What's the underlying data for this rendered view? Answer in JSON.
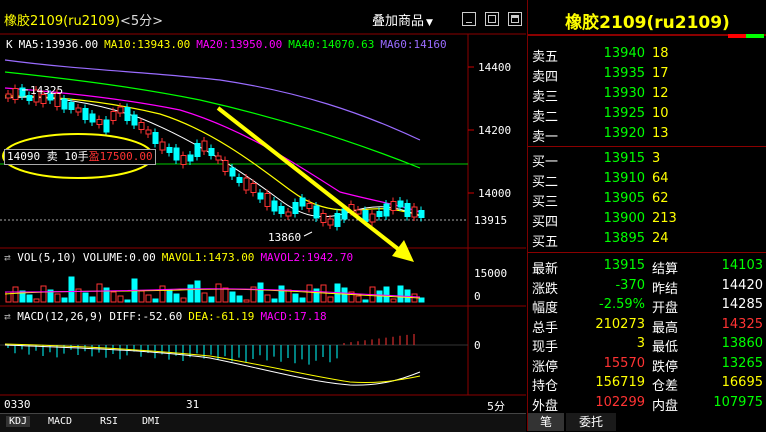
{
  "header": {
    "title": "橡胶2109(ru2109)",
    "period": "<5分>",
    "overlay_button": "叠加商品",
    "overlay_arrow": "▼"
  },
  "main": {
    "ma_legend": [
      {
        "label": "K",
        "color": "#ffffff"
      },
      {
        "label": "MA5:13936.00",
        "color": "#ffffff"
      },
      {
        "label": "MA10:13943.00",
        "color": "#ffff00"
      },
      {
        "label": "MA20:13950.00",
        "color": "#ff00ff"
      },
      {
        "label": "MA40:14070.63",
        "color": "#00ff00"
      },
      {
        "label": "MA60:14160",
        "color": "#9a6cff"
      }
    ],
    "price_ticks": [
      "14400",
      "14200",
      "14000"
    ],
    "current_price_tag": "13915",
    "high_label": "14325",
    "low_label": "13860",
    "order_tag": {
      "price": "14090",
      "side": "卖",
      "qty": "10手",
      "profit": "盈17500.00"
    }
  },
  "volume": {
    "legend": [
      {
        "label": "VOL(5,10)",
        "color": "#ffffff"
      },
      {
        "label": "VOLUME:0.00",
        "color": "#ffffff"
      },
      {
        "label": "MAVOL1:1473.00",
        "color": "#ffff00"
      },
      {
        "label": "MAVOL2:1942.70",
        "color": "#ff00ff"
      }
    ],
    "ticks": [
      "15000",
      "0"
    ]
  },
  "macd": {
    "legend": [
      {
        "label": "MACD(12,26,9)",
        "color": "#ffffff"
      },
      {
        "label": "DIFF:-52.60",
        "color": "#ffffff"
      },
      {
        "label": "DEA:-61.19",
        "color": "#ffff00"
      },
      {
        "label": "MACD:17.18",
        "color": "#ff00ff"
      }
    ],
    "ticks": [
      "0"
    ]
  },
  "time_axis": {
    "left": "0330",
    "mid": "31",
    "right": "5分"
  },
  "indicator_tabs": [
    "KDJ",
    "MACD",
    "RSI",
    "DMI"
  ],
  "quote": {
    "title": "橡胶2109(ru2109)",
    "asks": [
      {
        "label": "卖五",
        "price": "13940",
        "vol": "18"
      },
      {
        "label": "卖四",
        "price": "13935",
        "vol": "17"
      },
      {
        "label": "卖三",
        "price": "13930",
        "vol": "12"
      },
      {
        "label": "卖二",
        "price": "13925",
        "vol": "10"
      },
      {
        "label": "卖一",
        "price": "13920",
        "vol": "13"
      }
    ],
    "bids": [
      {
        "label": "买一",
        "price": "13915",
        "vol": "3"
      },
      {
        "label": "买二",
        "price": "13910",
        "vol": "64"
      },
      {
        "label": "买三",
        "price": "13905",
        "vol": "62"
      },
      {
        "label": "买四",
        "price": "13900",
        "vol": "213"
      },
      {
        "label": "买五",
        "price": "13895",
        "vol": "24"
      }
    ],
    "stats": [
      {
        "l1": "最新",
        "v1": "13915",
        "c1": "#00ff00",
        "l2": "结算",
        "v2": "14103",
        "c2": "#00ff00"
      },
      {
        "l1": "涨跌",
        "v1": "-370",
        "c1": "#00ff00",
        "l2": "昨结",
        "v2": "14420",
        "c2": "#ffffff"
      },
      {
        "l1": "幅度",
        "v1": "-2.59%",
        "c1": "#00ff00",
        "l2": "开盘",
        "v2": "14285",
        "c2": "#ffffff"
      },
      {
        "l1": "总手",
        "v1": "210273",
        "c1": "#ffff00",
        "l2": "最高",
        "v2": "14325",
        "c2": "#ff3333"
      },
      {
        "l1": "现手",
        "v1": "3",
        "c1": "#ffff00",
        "l2": "最低",
        "v2": "13860",
        "c2": "#00ff00"
      },
      {
        "l1": "涨停",
        "v1": "15570",
        "c1": "#ff3333",
        "l2": "跌停",
        "v2": "13265",
        "c2": "#00ff00"
      },
      {
        "l1": "持仓",
        "v1": "156719",
        "c1": "#ffff00",
        "l2": "仓差",
        "v2": "16695",
        "c2": "#ffff00"
      },
      {
        "l1": "外盘",
        "v1": "102299",
        "c1": "#ff3333",
        "l2": "内盘",
        "v2": "107975",
        "c2": "#00ff00"
      }
    ],
    "bottom_tabs": [
      "笔",
      "委托"
    ]
  }
}
